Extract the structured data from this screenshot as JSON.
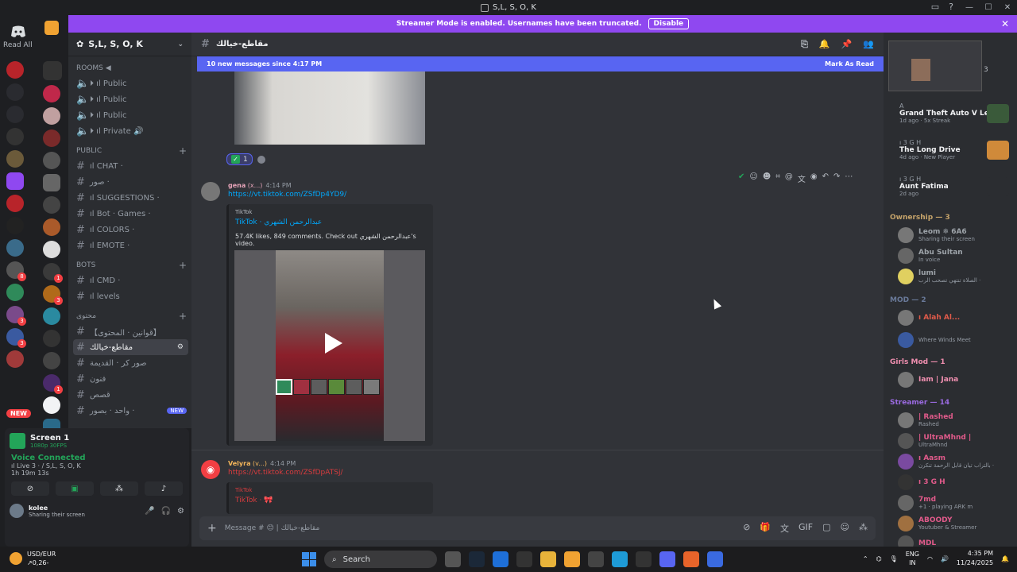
{
  "window": {
    "title": "S,L, S, O, K"
  },
  "banner": {
    "text": "Streamer Mode is enabled. Usernames have been truncated.",
    "button": "Disable"
  },
  "guilds": {
    "read_all": "Read All",
    "new_label": "NEW",
    "badges": [
      "1",
      "8",
      "3",
      "3",
      "3",
      "1",
      "4"
    ]
  },
  "server": {
    "name": "S,L, S, O, K"
  },
  "categories": {
    "rooms": "ROOMS ◀",
    "public": "PUBLIC",
    "bots": "BOTS",
    "content": "محتوى"
  },
  "channels": {
    "rooms": [
      "⏵ ıl Public",
      "⏵ ıl Public",
      "⏵ ıl Public",
      "⏵ ıl Private 🔊"
    ],
    "public": [
      "ıl CHAT ·",
      "صور ·",
      "ıl SUGGESTIONS ·",
      "ıl Bot · Games ·",
      "ıl COLORS ·",
      "ıl EMOTE ·"
    ],
    "bots": [
      "ıl CMD ·",
      "ıl levels"
    ],
    "content": [
      "【قوانين · المحتوى】",
      "مقاطع-خيالك",
      "صور كر · القديمة",
      "فنون",
      "قصص",
      "واحد · بصور ·"
    ],
    "new_tag": "NEW"
  },
  "screen": {
    "title": "Screen 1",
    "sub": "1080p 30FPS"
  },
  "voice": {
    "status": "Voice Connected",
    "channel": "ıl Live 3 · / S,L, S, O, K",
    "time": "1h 19m 13s"
  },
  "account": {
    "name": "kolee",
    "status": "Sharing their screen"
  },
  "chat": {
    "channel": "مقاطع-خيالك",
    "new_messages": "10 new messages since 4:17 PM",
    "mark_read": "Mark As Read",
    "reaction_count": "1",
    "messages": [
      {
        "author": "gena",
        "tag": "(x...)",
        "time": "4:14 PM",
        "link": "https://vt.tiktok.com/ZSfDp4YD9/",
        "embed_provider": "TikTok",
        "embed_title": "TikTok · عبدالرحمن الشهري",
        "embed_desc": "57.4K likes, 849 comments. Check out عبدالرحمن الشهري's video."
      },
      {
        "author": "Velyra",
        "tag": "(v...)",
        "time": "4:14 PM",
        "link": "https://vt.tiktok.com/ZSfDpATSj/",
        "embed_provider": "TikTok",
        "embed_title": "TikTok · 🎀"
      }
    ],
    "composer_placeholder": "Message # 😊 | مقاطع-خيالك"
  },
  "members": {
    "stream_count": "3",
    "activities": [
      {
        "name": "A",
        "title": "Grand Theft Auto V Legacy",
        "sub": "1d ago · 5x Streak"
      },
      {
        "name": "ı 3 G H",
        "title": "The Long Drive",
        "sub": "4d ago · New Player"
      },
      {
        "name": "ı 3 G H",
        "title": "Aunt Fatima",
        "sub": "2d ago"
      }
    ],
    "groups": {
      "ownership": "Ownership — 3",
      "mod": "MOD — 2",
      "girls_mod": "Girls Mod — 1",
      "streamer": "Streamer — 14"
    },
    "list": [
      {
        "name": "Leom ❄ 6A6",
        "status": "Sharing their screen",
        "color": "#9da3a9"
      },
      {
        "name": "Abu Sultan",
        "status": "In voice",
        "color": "#9da3a9"
      },
      {
        "name": "lumi",
        "status": "الصلاة تنتهي تصحب الرب ·",
        "color": "#9da3a9"
      },
      {
        "name": "ı Alah Al...",
        "status": "",
        "color": "#e05a4a"
      },
      {
        "name": "",
        "status": "Where Winds Meet",
        "color": "#9da3a9"
      },
      {
        "name": "Iam | Jana",
        "status": "",
        "color": "#f08fb0"
      },
      {
        "name": "| Rashed",
        "status": "Rashed",
        "color": "#e05a8a"
      },
      {
        "name": "| UltraMhnd |",
        "status": "UltraMhnd",
        "color": "#e05a8a"
      },
      {
        "name": "ı Aasm",
        "status": "بالتراب تيان قابل الرحمة تنكرن ·",
        "color": "#e05a8a"
      },
      {
        "name": "ı 3 G H",
        "status": "",
        "color": "#e05a8a"
      },
      {
        "name": "7md",
        "status": "+1 · playing ARK m",
        "color": "#e05a8a"
      },
      {
        "name": "ABOODY",
        "status": "Youtuber & Streamer",
        "color": "#e05a8a"
      },
      {
        "name": "MDL",
        "status": "",
        "color": "#e05a8a"
      }
    ]
  },
  "taskbar": {
    "weather_pair": "USD/EUR",
    "weather_val": "↗0,26-",
    "search": "Search",
    "lang1": "ENG",
    "lang2": "IN",
    "time": "4:35 PM",
    "date": "11/24/2025"
  }
}
